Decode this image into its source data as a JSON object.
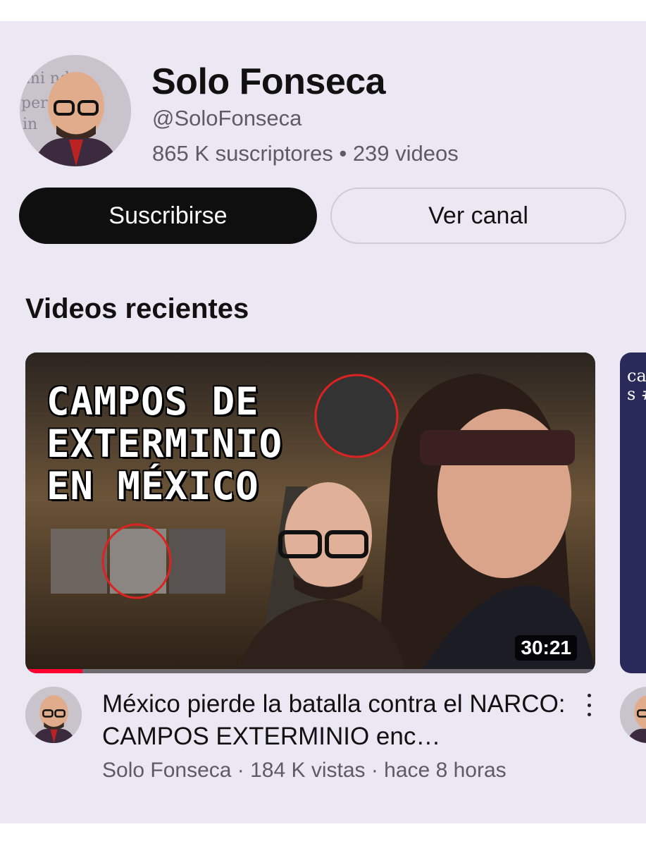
{
  "channel": {
    "name": "Solo Fonseca",
    "handle": "@SoloFonseca",
    "stats": "865 K suscriptores • 239 videos",
    "avatar_icon": "person-avatar"
  },
  "buttons": {
    "subscribe": "Suscribirse",
    "view_channel": "Ver canal"
  },
  "recent": {
    "title": "Videos recientes"
  },
  "video": {
    "thumbnail_text": [
      "CAMPOS DE",
      "EXTERMINIO",
      "EN MÉXICO"
    ],
    "duration": "30:21",
    "progress": 0.1,
    "title": "México pierde la batalla contra el NARCO: CAMPOS EXTERMINIO enc…",
    "meta": "Solo Fonseca · 184 K vistas · hace 8 horas"
  },
  "next_video": {
    "thumbnail_text": [
      "can",
      "s #"
    ]
  },
  "colors": {
    "background": "#ebe7f3",
    "subscribe_bg": "#0f0f0f",
    "progress": "#ff0033"
  }
}
